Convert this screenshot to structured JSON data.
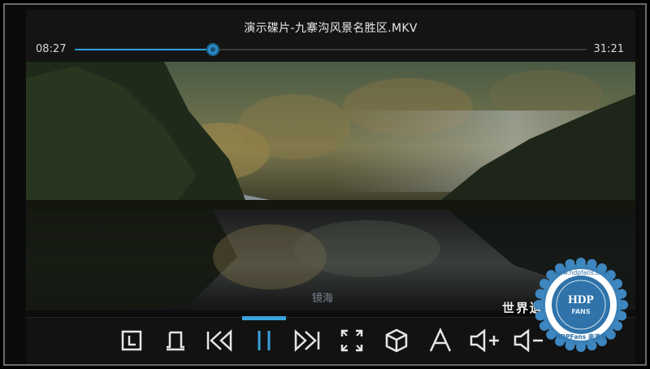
{
  "player": {
    "title": "演示碟片-九寨沟风景名胜区.MKV",
    "time_current": "08:27",
    "time_total": "31:21",
    "progress": 0.27
  },
  "video": {
    "subtitle_text": "镜海",
    "caption_text": "世界遗产"
  },
  "controls": {
    "items": [
      {
        "name": "chapter-icon",
        "active": false
      },
      {
        "name": "bookmark-icon",
        "active": false
      },
      {
        "name": "previous-icon",
        "active": false
      },
      {
        "name": "pause-icon",
        "active": true
      },
      {
        "name": "next-icon",
        "active": false
      },
      {
        "name": "fullscreen-icon",
        "active": false
      },
      {
        "name": "3d-mode-icon",
        "active": false
      },
      {
        "name": "subtitle-font-icon",
        "active": false
      },
      {
        "name": "volume-up-icon",
        "active": false
      },
      {
        "name": "volume-down-icon",
        "active": false
      }
    ],
    "accent_color": "#39a3dc"
  },
  "watermark": {
    "url_text": "www.hdpfans.com",
    "logo_text": "HDP",
    "sub_text": "FANS",
    "bottom_text": "HDPFans 高清范"
  }
}
